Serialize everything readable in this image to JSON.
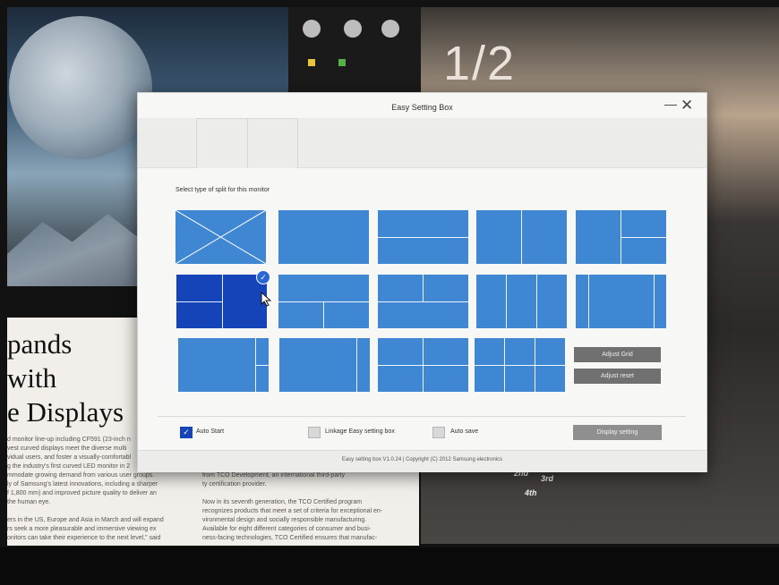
{
  "background": {
    "counter": "1/2",
    "headline_lines": [
      "pands",
      "with",
      "e Displays"
    ],
    "article_left": [
      "d monitor line-up including CF591 (23-inch n",
      "vest curved displays meet the diverse multi",
      "vidual users, and foster a visually-comfortabl",
      "g the industry's first curved LED monitor in 2",
      "mmodate growing demand from various user groups.",
      "ly of Samsung's latest innovations, including a sharper",
      "f 1,800 mm) and improved picture quality to deliver an",
      "the human eye.",
      "",
      "ers in the US, Europe and Asia in March and will expand",
      "rs seek a more pleasurable and immersive viewing ex",
      "onitors can take their experience to the next level,\" said"
    ],
    "article_right": [
      "from TCO Development, an international third-party",
      "ty certification provider.",
      "",
      "Now in its seventh generation, the TCO Certified program",
      "recognizes products that meet a set of criteria for exceptional en-",
      "vironmental design and socially responsible manufacturing.",
      "Available for eight different categories of consumer and busi-",
      "ness-facing technologies, TCO Certified ensures that manufac-"
    ],
    "ranks": [
      "2nd",
      "3rd",
      "4th"
    ]
  },
  "dialog": {
    "title": "Easy Setting Box",
    "minimize_glyph": "—",
    "close_glyph": "✕",
    "instruction": "Select type of split for this monitor",
    "selected_check": "✓",
    "buttons": {
      "adjust_grid": "Adjust Grid",
      "adjust_reset": "Adjust reset",
      "display_setting": "Display setting"
    },
    "options": {
      "auto_start": {
        "label": "Auto Start",
        "checked": true,
        "mark": "✓"
      },
      "linkage": {
        "label": "Linkage Easy setting box",
        "checked": false
      },
      "auto_save": {
        "label": "Auto save",
        "checked": false
      }
    },
    "status": "Easy setting box V1.0.24 | Copyright (C) 2012 Samsung electronics",
    "colors": {
      "tile": "#3f87d3",
      "tile_selected": "#1544b8",
      "button": "#707070"
    }
  }
}
